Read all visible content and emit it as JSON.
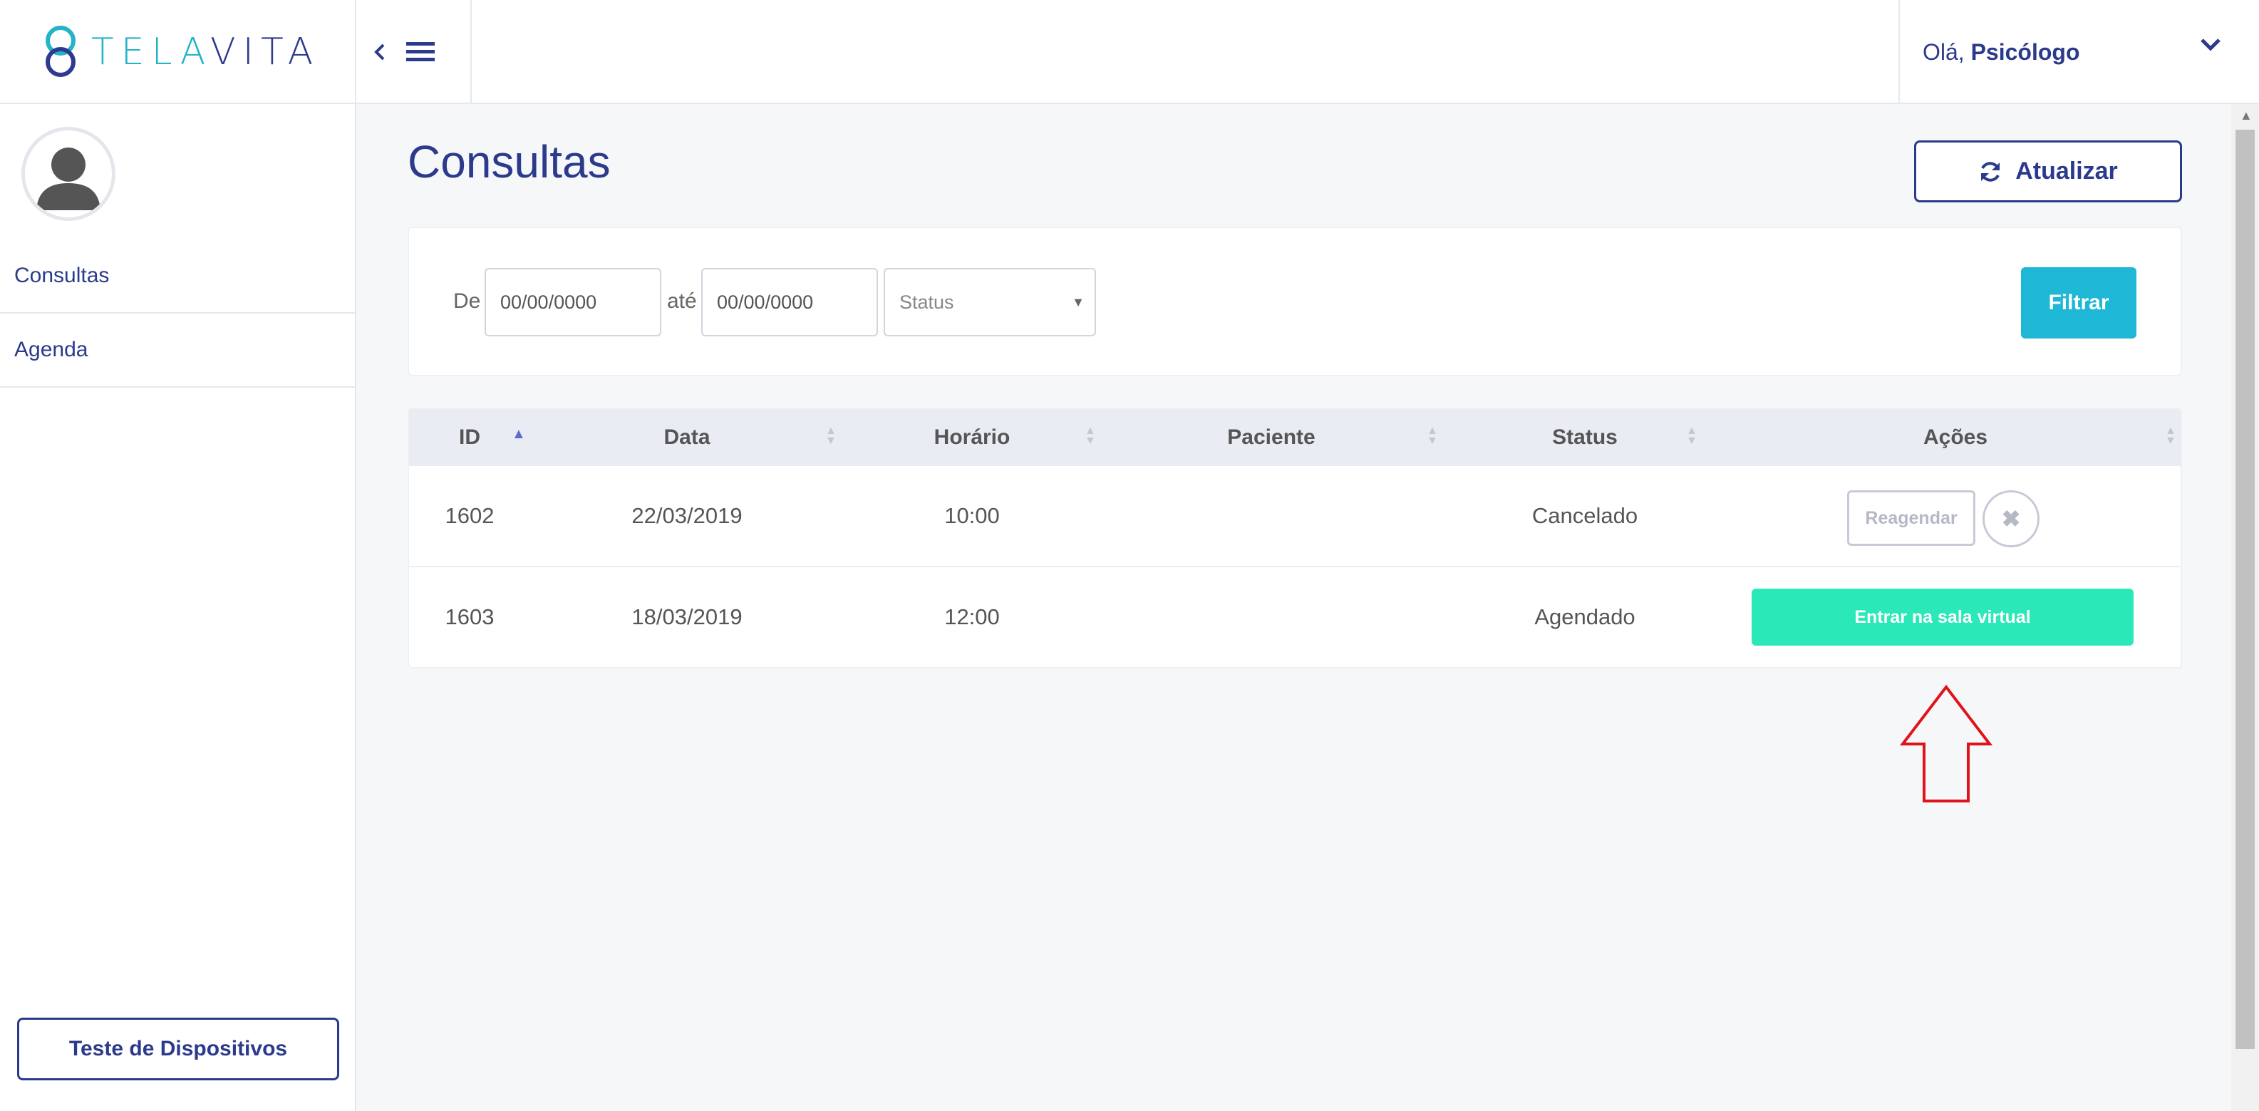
{
  "brand": {
    "logo_part1": "TELA",
    "logo_part2": "VITA"
  },
  "header": {
    "greeting_prefix": "Olá, ",
    "user_name": "Psicólogo"
  },
  "sidebar": {
    "items": [
      {
        "label": "Consultas"
      },
      {
        "label": "Agenda"
      }
    ],
    "device_test_label": "Teste de Dispositivos"
  },
  "main": {
    "title": "Consultas",
    "refresh_label": "Atualizar",
    "filter": {
      "from_label": "De",
      "from_value": "00/00/0000",
      "to_label": "até",
      "to_value": "00/00/0000",
      "status_placeholder": "Status",
      "filter_label": "Filtrar"
    },
    "table": {
      "columns": [
        "ID",
        "Data",
        "Horário",
        "Paciente",
        "Status",
        "Ações"
      ],
      "rows": [
        {
          "id": "1602",
          "date": "22/03/2019",
          "time": "10:00",
          "patient": "",
          "status": "Cancelado",
          "actions": {
            "reschedule": "Reagendar",
            "cancel_icon": "close-icon"
          }
        },
        {
          "id": "1603",
          "date": "18/03/2019",
          "time": "12:00",
          "patient": "",
          "status": "Agendado",
          "actions": {
            "enter": "Entrar na sala virtual"
          }
        }
      ]
    }
  },
  "colors": {
    "primary": "#2c3a8c",
    "teal": "#23b4c8",
    "filter_button": "#1fb7d6",
    "enter_button": "#2ae8b7",
    "annotation_arrow": "#e0131b"
  },
  "icons": [
    "back-chevron-icon",
    "hamburger-menu-icon",
    "chevron-down-icon",
    "user-avatar-icon",
    "refresh-icon",
    "close-icon",
    "sort-icon",
    "arrow-up-annotation-icon"
  ]
}
